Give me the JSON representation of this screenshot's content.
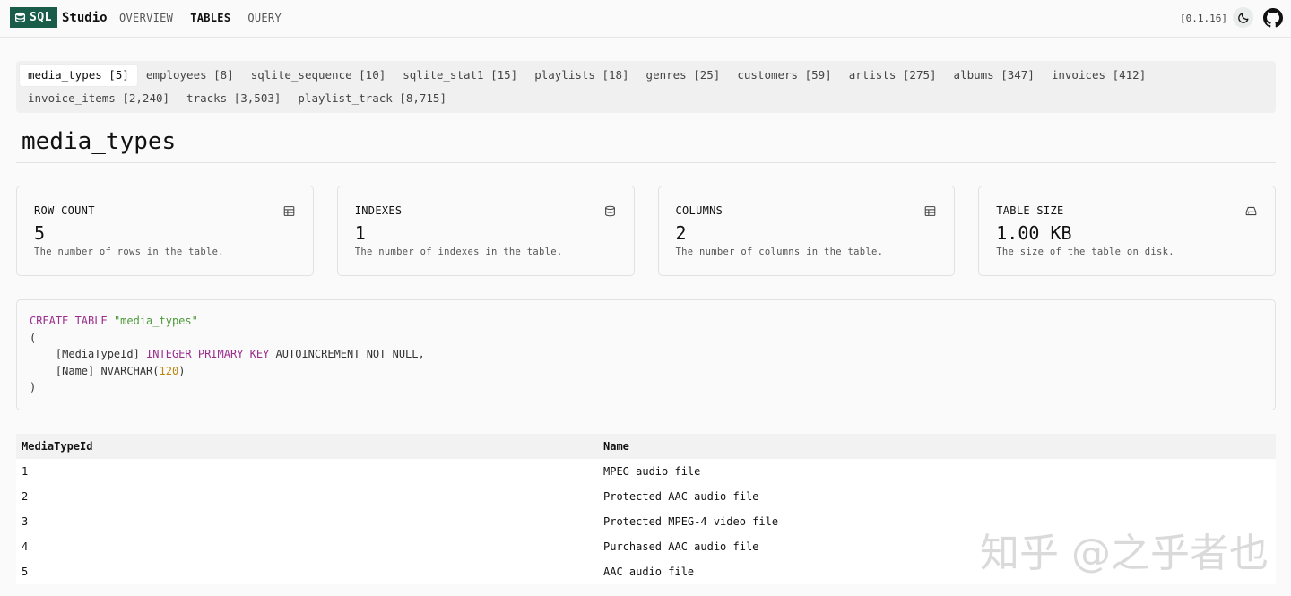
{
  "app": {
    "logo_badge": "SQL",
    "logo_text": "Studio",
    "version": "[0.1.16]"
  },
  "nav": [
    {
      "label": "OVERVIEW",
      "active": false
    },
    {
      "label": "TABLES",
      "active": true
    },
    {
      "label": "QUERY",
      "active": false
    }
  ],
  "tabs": [
    {
      "label": "media_types [5]",
      "active": true
    },
    {
      "label": "employees [8]"
    },
    {
      "label": "sqlite_sequence [10]"
    },
    {
      "label": "sqlite_stat1 [15]"
    },
    {
      "label": "playlists [18]"
    },
    {
      "label": "genres [25]"
    },
    {
      "label": "customers [59]"
    },
    {
      "label": "artists [275]"
    },
    {
      "label": "albums [347]"
    },
    {
      "label": "invoices [412]"
    },
    {
      "label": "invoice_items [2,240]"
    },
    {
      "label": "tracks [3,503]"
    },
    {
      "label": "playlist_track [8,715]"
    }
  ],
  "page_title": "media_types",
  "cards": [
    {
      "label": "ROW COUNT",
      "value": "5",
      "desc": "The number of rows in the table.",
      "icon": "table-icon"
    },
    {
      "label": "INDEXES",
      "value": "1",
      "desc": "The number of indexes in the table.",
      "icon": "database-icon"
    },
    {
      "label": "COLUMNS",
      "value": "2",
      "desc": "The number of columns in the table.",
      "icon": "table-icon"
    },
    {
      "label": "TABLE SIZE",
      "value": "1.00 KB",
      "desc": "The size of the table on disk.",
      "icon": "hard-drive-icon"
    }
  ],
  "sql": {
    "l1_kw": "CREATE TABLE",
    "l1_str": "\"media_types\"",
    "l2": "(",
    "l3_a": "    [MediaTypeId] ",
    "l3_kw": "INTEGER PRIMARY KEY",
    "l3_b": " AUTOINCREMENT NOT NULL,",
    "l4_a": "    [Name] NVARCHAR(",
    "l4_num": "120",
    "l4_b": ")",
    "l5": ")"
  },
  "table": {
    "columns": [
      "MediaTypeId",
      "Name"
    ],
    "rows": [
      [
        "1",
        "MPEG audio file"
      ],
      [
        "2",
        "Protected AAC audio file"
      ],
      [
        "3",
        "Protected MPEG-4 video file"
      ],
      [
        "4",
        "Purchased AAC audio file"
      ],
      [
        "5",
        "AAC audio file"
      ]
    ]
  },
  "watermark": "知乎 @之乎者也"
}
